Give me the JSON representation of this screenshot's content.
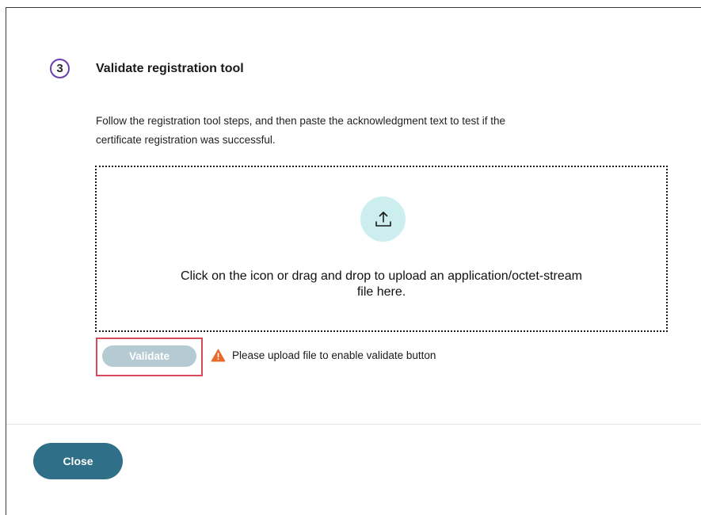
{
  "step": {
    "number": "3",
    "title": "Validate registration tool",
    "description_line1": "Follow the registration tool steps, and then paste the acknowledgment text to test if the",
    "description_line2": "certificate registration was successful."
  },
  "upload": {
    "icon": "upload-icon",
    "text_line1": "Click on the icon or drag and drop to upload an application/octet-stream",
    "text_line2": "file here."
  },
  "validate": {
    "label": "Validate",
    "enabled": false,
    "warning_icon": "warning-icon",
    "warning_text": "Please upload file to enable validate button"
  },
  "footer": {
    "close_label": "Close"
  },
  "colors": {
    "step_badge_border": "#6b3fb0",
    "upload_circle": "#cdeeee",
    "validate_disabled": "#b4cbd4",
    "highlight_border": "#d84a5a",
    "warning": "#e86a2a",
    "close_button": "#2f6f88"
  }
}
